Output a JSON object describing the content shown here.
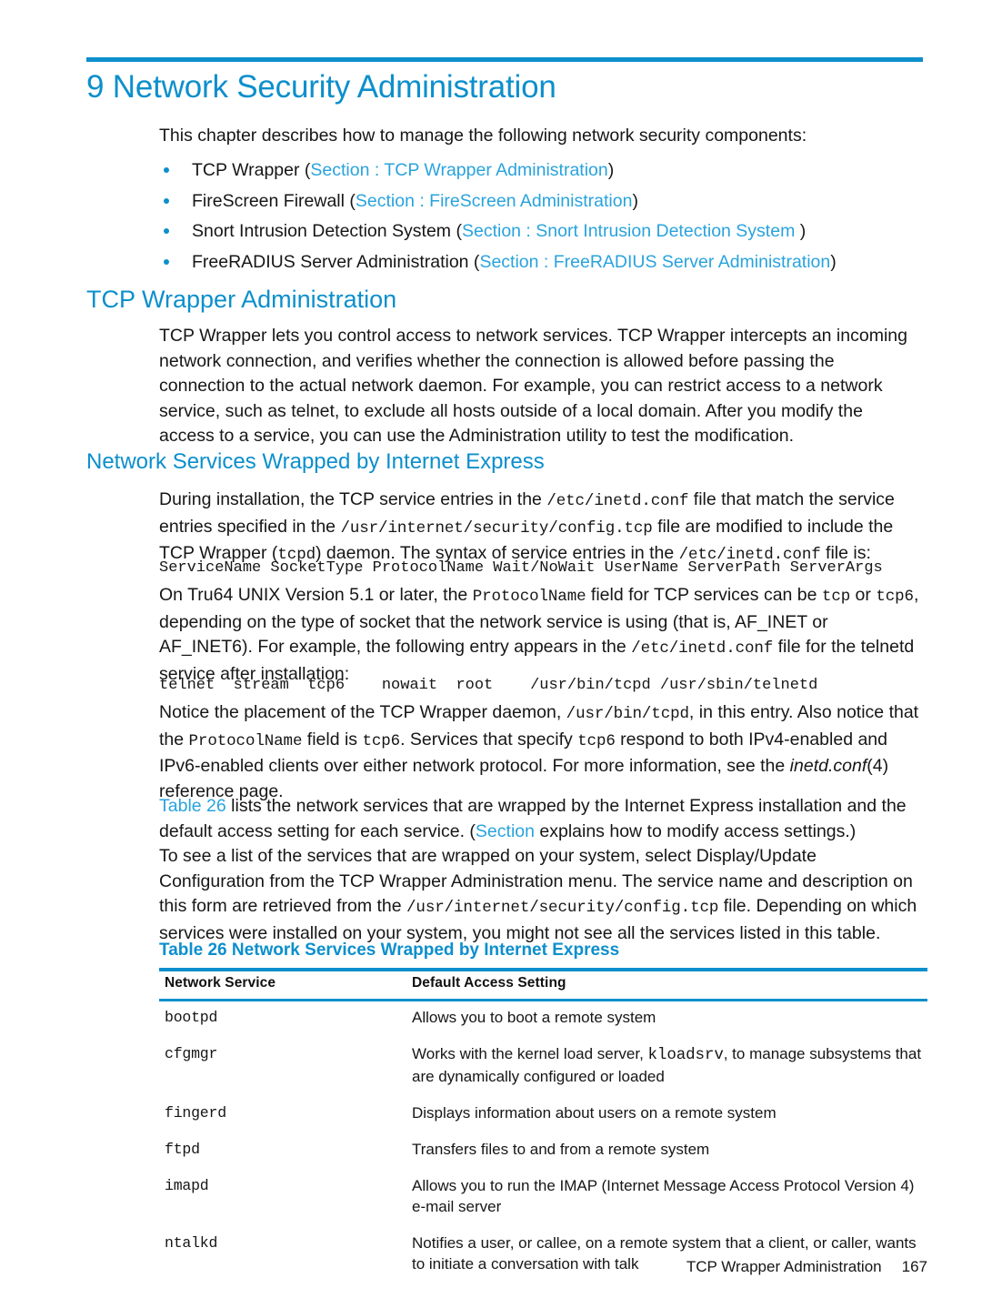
{
  "document": {
    "chapter_number_title": "9 Network Security Administration",
    "accent_color": "#0c8fcc",
    "link_color": "#29a3dd"
  },
  "intro": {
    "paragraph": "This chapter describes how to manage the following network security components:"
  },
  "bullets": [
    {
      "text": "TCP Wrapper (",
      "link": "Section : TCP Wrapper Administration",
      "tail": ")"
    },
    {
      "text": "FireScreen Firewall (",
      "link": "Section : FireScreen Administration",
      "tail": ")"
    },
    {
      "text": "Snort Intrusion Detection System (",
      "link": "Section : Snort Intrusion Detection System ",
      "tail": ")"
    },
    {
      "text": "FreeRADIUS Server Administration (",
      "link": "Section : FreeRADIUS Server Administration",
      "tail": ")"
    }
  ],
  "sections": {
    "tcp_wrapper_administration": {
      "heading": "TCP Wrapper Administration",
      "paragraph": "TCP Wrapper lets you control access to network services. TCP Wrapper intercepts an incoming network connection, and verifies whether the connection is allowed before passing the connection to the actual network daemon. For example, you can restrict access to a network service, such as telnet, to exclude all hosts outside of a local domain. After you modify the access to a service, you can use the Administration utility to test the modification."
    },
    "network_services_wrapped": {
      "heading": "Network Services Wrapped by Internet Express",
      "p_during_1": "During installation, the TCP service entries in the ",
      "p_during_code_1": "/etc/inetd.conf",
      "p_during_2": " file that match the service entries specified in the ",
      "p_during_code_2": "/usr/internet/security/config.tcp",
      "p_during_3": " file are modified to include the TCP Wrapper (",
      "p_during_code_3": "tcpd",
      "p_during_4": ") daemon. The syntax of service entries in the ",
      "p_during_code_4": "/etc/inetd.conf",
      "p_during_5": " file is:",
      "code_syntax": "ServiceName SocketType ProtocolName Wait/NoWait UserName ServerPath ServerArgs",
      "p_ontru64_1": "On Tru64 UNIX Version 5.1 or later, the ",
      "p_ontru64_code_1": "ProtocolName",
      "p_ontru64_2": " field for TCP services can be ",
      "p_ontru64_code_2": "tcp",
      "p_ontru64_3": " or ",
      "p_ontru64_code_3": "tcp6",
      "p_ontru64_4": ", depending on the type of socket that the network service is using (that is, AF_INET or AF_INET6). For example, the following entry appears in the ",
      "p_ontru64_code_4": "/etc/inetd.conf",
      "p_ontru64_5": " file for the telnetd service after installation:",
      "code_telnet": "telnet  stream  tcp6    nowait  root    /usr/bin/tcpd /usr/sbin/telnetd",
      "p_notice_1": "Notice the placement of the TCP Wrapper daemon, ",
      "p_notice_code_1": "/usr/bin/tcpd",
      "p_notice_2": ", in this entry. Also notice that the ",
      "p_notice_code_2": "ProtocolName",
      "p_notice_3": " field is ",
      "p_notice_code_3": "tcp6",
      "p_notice_4": ". Services that specify ",
      "p_notice_code_4": "tcp6",
      "p_notice_5": " respond to both IPv4-enabled and IPv6-enabled clients over either network protocol. For more information, see the ",
      "p_notice_italic": "inetd.conf",
      "p_notice_6": "(4) reference page.",
      "p_table26_link": "Table 26",
      "p_table26_1": " lists the network services that are wrapped by the Internet Express installation and the default access setting for each service. (",
      "p_table26_link2": "Section",
      "p_table26_2": " explains how to modify access settings.)",
      "p_tosee_1": "To see a list of the services that are wrapped on your system, select Display/Update Configuration from the TCP Wrapper Administration menu. The service name and description on this form are retrieved from the ",
      "p_tosee_code": "/usr/internet/security/config.tcp",
      "p_tosee_2": " file. Depending on which services were installed on your system, you might not see all the services listed in this table."
    }
  },
  "table": {
    "caption": "Table 26 Network Services Wrapped by Internet Express",
    "columns": [
      "Network Service",
      "Default Access Setting"
    ],
    "rows": [
      {
        "service": "bootpd",
        "setting_parts": [
          {
            "t": "Allows you to boot a remote system",
            "mono": false
          }
        ]
      },
      {
        "service": "cfgmgr",
        "setting_parts": [
          {
            "t": "Works with the kernel load server, ",
            "mono": false
          },
          {
            "t": "kloadsrv",
            "mono": true
          },
          {
            "t": ", to manage subsystems that are dynamically configured or loaded",
            "mono": false
          }
        ]
      },
      {
        "service": "fingerd",
        "setting_parts": [
          {
            "t": "Displays information about users on a remote system",
            "mono": false
          }
        ]
      },
      {
        "service": "ftpd",
        "setting_parts": [
          {
            "t": "Transfers files to and from a remote system",
            "mono": false
          }
        ]
      },
      {
        "service": "imapd",
        "setting_parts": [
          {
            "t": "Allows you to run the IMAP (Internet Message Access Protocol Version 4) e-mail server",
            "mono": false
          }
        ]
      },
      {
        "service": "ntalkd",
        "setting_parts": [
          {
            "t": "Notifies a user, or callee, on a remote system that a client, or caller, wants to initiate a conversation with talk",
            "mono": false
          }
        ]
      }
    ]
  },
  "footer": {
    "section_label": "TCP Wrapper Administration",
    "page_number": "167"
  }
}
